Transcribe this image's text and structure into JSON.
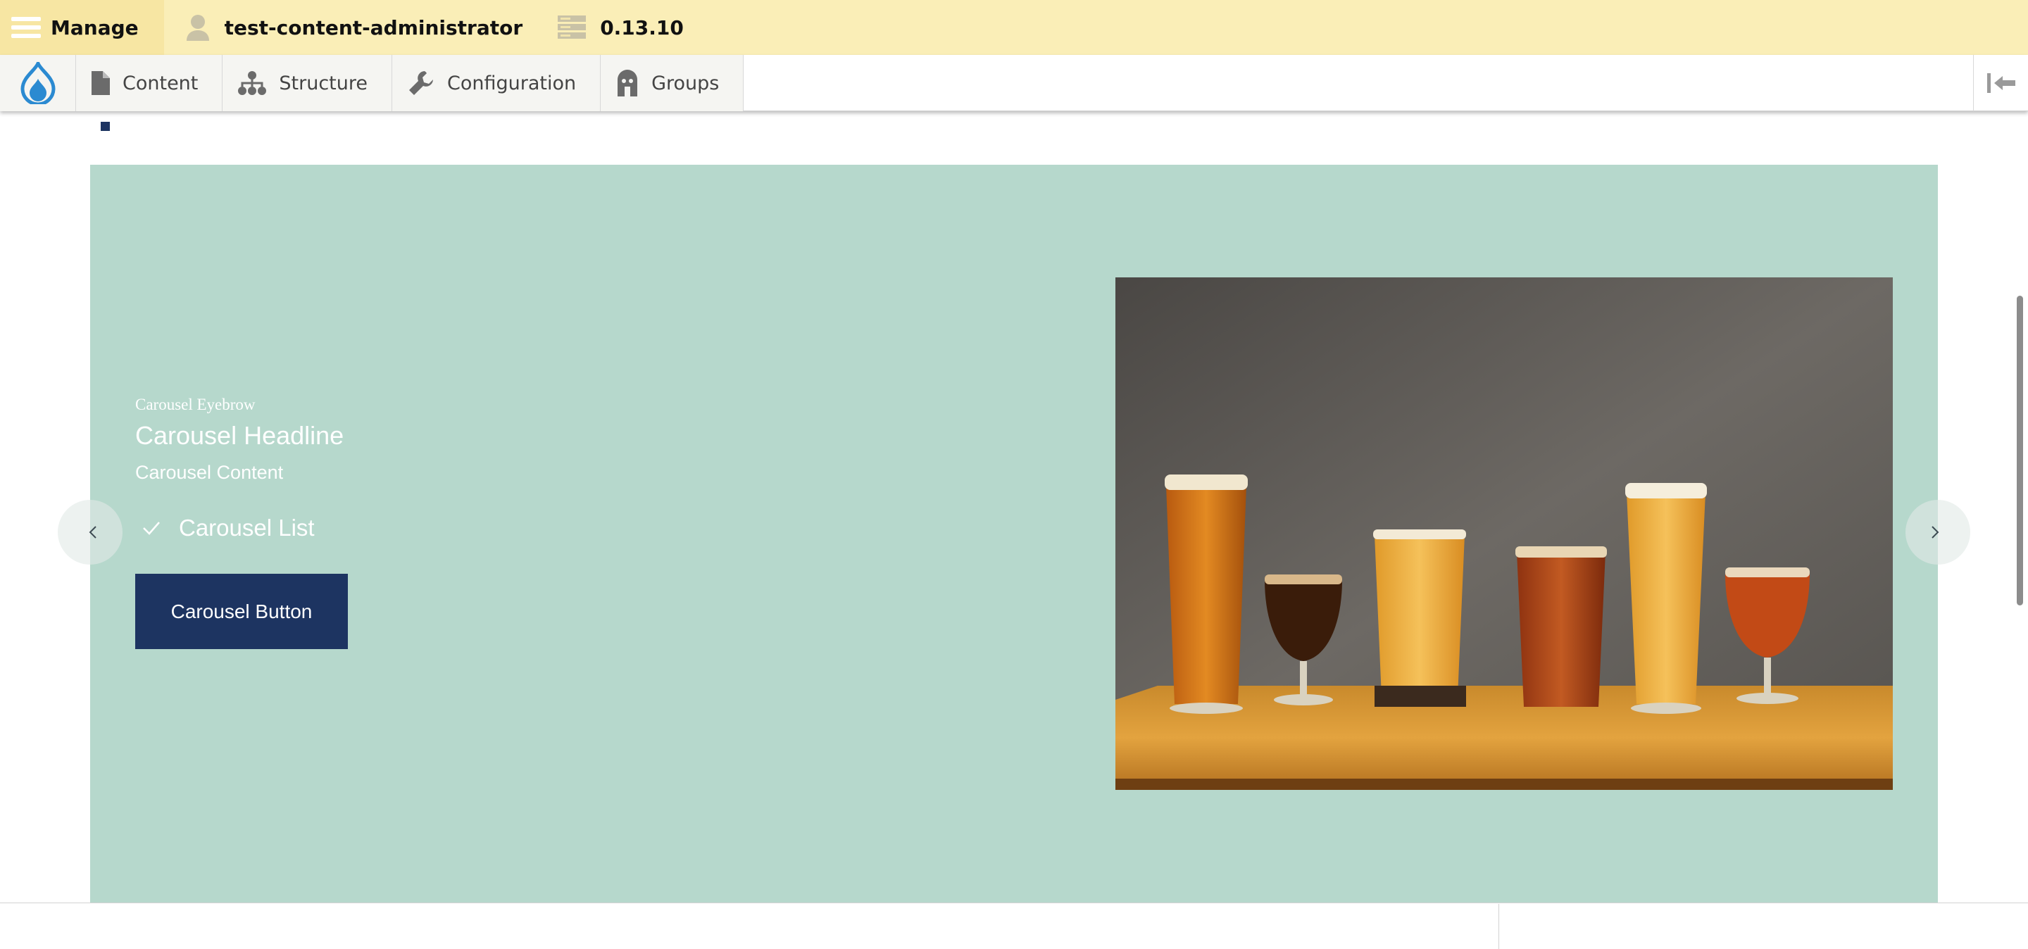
{
  "admin_bar": {
    "manage_label": "Manage",
    "user_label": "test-content-administrator",
    "version_label": "0.13.10"
  },
  "toolbar": {
    "items": [
      {
        "label": "Content",
        "icon": "file-icon"
      },
      {
        "label": "Structure",
        "icon": "sitemap-icon"
      },
      {
        "label": "Configuration",
        "icon": "wrench-icon"
      },
      {
        "label": "Groups",
        "icon": "groups-icon"
      }
    ]
  },
  "carousel": {
    "eyebrow": "Carousel Eyebrow",
    "headline": "Carousel Headline",
    "content": "Carousel Content",
    "list_item": "Carousel List",
    "button_label": "Carousel Button",
    "background_color": "#b6d8cc",
    "button_color": "#1d3461",
    "image": "beer-glasses-photo"
  }
}
